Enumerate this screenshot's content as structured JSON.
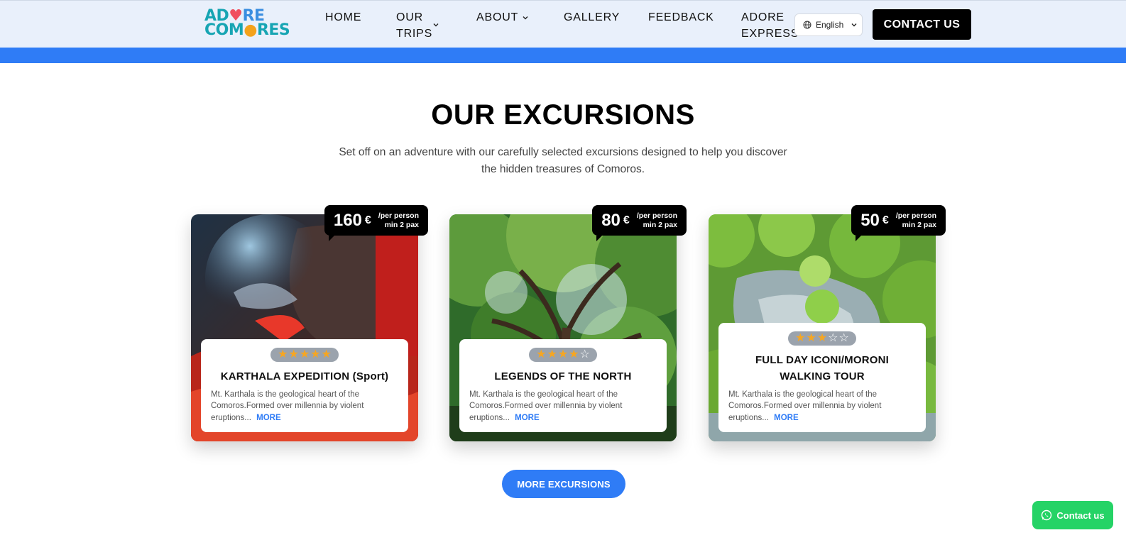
{
  "header": {
    "logo_top": "ADORE",
    "logo_bottom": "COMORES",
    "nav": [
      {
        "label": "HOME"
      },
      {
        "label_line1": "OUR",
        "label_line2": "TRIPS"
      },
      {
        "label": "ABOUT"
      },
      {
        "label": "GALLERY"
      },
      {
        "label": "FEEDBACK"
      },
      {
        "label_line1": "ADORE",
        "label_line2": "EXPRESS"
      }
    ],
    "language": "English",
    "contact_label": "CONTACT US"
  },
  "section": {
    "title": "OUR EXCURSIONS",
    "subtitle": "Set off on an adventure with our carefully selected excursions designed to help you discover the hidden treasures of Comoros."
  },
  "cards": [
    {
      "price": "160",
      "currency": "€",
      "per": "/per person",
      "min": "min 2 pax",
      "rating": 5,
      "title": "KARTHALA EXPEDITION (Sport)",
      "description": "Mt. Karthala is the geological heart of the Comoros.Formed over millennia by violent eruptions...",
      "more": "MORE"
    },
    {
      "price": "80",
      "currency": "€",
      "per": "/per person",
      "min": "min 2 pax",
      "rating": 4,
      "title": "LEGENDS OF THE NORTH",
      "description": "Mt. Karthala is the geological heart of the Comoros.Formed over millennia by violent eruptions...",
      "more": "MORE"
    },
    {
      "price": "50",
      "currency": "€",
      "per": "/per person",
      "min": "min 2 pax",
      "rating": 3,
      "title": "FULL DAY ICONI/MORONI WALKING TOUR",
      "description": "Mt. Karthala is the geological heart of the Comoros.Formed over millennia by violent eruptions...",
      "more": "MORE"
    }
  ],
  "more_excursions_label": "MORE EXCURSIONS",
  "whatsapp_label": "Contact us",
  "colors": {
    "accent": "#2f7cf6",
    "header_bg": "#e9f0fb",
    "whatsapp": "#25d366",
    "star": "#f5a623"
  }
}
